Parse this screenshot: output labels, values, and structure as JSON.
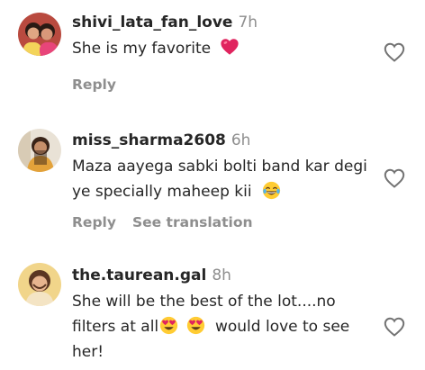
{
  "comments": [
    {
      "username": "shivi_lata_fan_love",
      "time": "7h",
      "text_before": "She is my favorite",
      "text_after": "",
      "emoji": [
        "red-heart"
      ],
      "actions": [
        "Reply"
      ]
    },
    {
      "username": "miss_sharma2608",
      "time": "6h",
      "text_before": "Maza aayega sabki bolti band kar degi ye specially maheep kii",
      "text_after": "",
      "emoji": [
        "tears-of-joy"
      ],
      "actions": [
        "Reply",
        "See translation"
      ]
    },
    {
      "username": "the.taurean.gal",
      "time": "8h",
      "text_before": "She will be the best of the lot....no filters at all",
      "text_after": "would love to see her!",
      "emoji": [
        "heart-eyes",
        "heart-eyes"
      ],
      "actions": []
    }
  ],
  "colors": {
    "text": "#262626",
    "muted": "#8e8e8e",
    "heart_emoji": "#e0245e",
    "emoji_face": "#ffcc33"
  },
  "icons": {
    "like": "heart-outline-icon"
  }
}
